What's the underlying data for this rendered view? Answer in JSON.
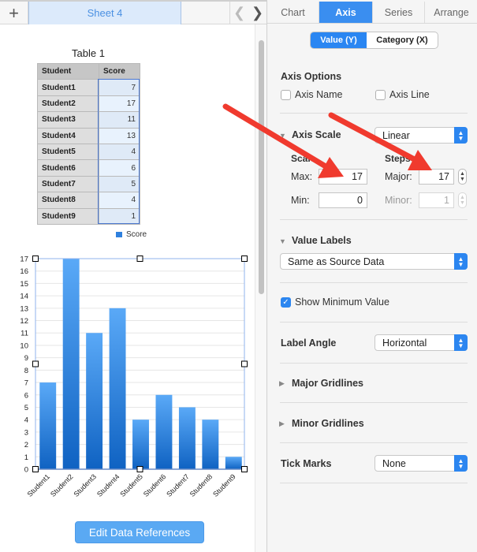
{
  "sheet_bar": {
    "add_icon": "plus-icon",
    "active_sheet": "Sheet 4",
    "prev_icon": "chevron-left-icon",
    "next_icon": "chevron-right-icon"
  },
  "table": {
    "title": "Table 1",
    "headers": [
      "Student",
      "Score"
    ],
    "rows": [
      {
        "student": "Student1",
        "score": "7"
      },
      {
        "student": "Student2",
        "score": "17"
      },
      {
        "student": "Student3",
        "score": "11"
      },
      {
        "student": "Student4",
        "score": "13"
      },
      {
        "student": "Student5",
        "score": "4"
      },
      {
        "student": "Student6",
        "score": "6"
      },
      {
        "student": "Student7",
        "score": "5"
      },
      {
        "student": "Student8",
        "score": "4"
      },
      {
        "student": "Student9",
        "score": "1"
      }
    ]
  },
  "chart_data": {
    "type": "bar",
    "categories": [
      "Student1",
      "Student2",
      "Student3",
      "Student4",
      "Student5",
      "Student6",
      "Student7",
      "Student8",
      "Student9"
    ],
    "series": [
      {
        "name": "Score",
        "values": [
          7,
          17,
          11,
          13,
          4,
          6,
          5,
          4,
          1
        ],
        "color": "#2f80de"
      }
    ],
    "title": "",
    "xlabel": "",
    "ylabel": "",
    "ylim": [
      0,
      17
    ],
    "yticks": [
      0,
      1,
      2,
      3,
      4,
      5,
      6,
      7,
      8,
      9,
      10,
      11,
      12,
      13,
      14,
      15,
      16,
      17
    ],
    "grid": true,
    "legend": "top-center",
    "x_label_rotation": "diagonal"
  },
  "edit_button": "Edit Data References",
  "inspector": {
    "tabs": [
      {
        "label": "Chart",
        "active": false
      },
      {
        "label": "Axis",
        "active": true
      },
      {
        "label": "Series",
        "active": false
      },
      {
        "label": "Arrange",
        "active": false
      }
    ],
    "segments": {
      "value": "Value (Y)",
      "category": "Category (X)",
      "selected": "Value (Y)"
    },
    "axis_options": {
      "heading": "Axis Options",
      "axis_name": {
        "label": "Axis Name",
        "checked": false
      },
      "axis_line": {
        "label": "Axis Line",
        "checked": false
      }
    },
    "axis_scale": {
      "heading": "Axis Scale",
      "select": "Linear",
      "scale_heading": "Scale",
      "steps_heading": "Steps",
      "max_label": "Max:",
      "max_value": "17",
      "min_label": "Min:",
      "min_value": "0",
      "major_label": "Major:",
      "major_value": "17",
      "minor_label": "Minor:",
      "minor_value": "1"
    },
    "value_labels": {
      "heading": "Value Labels",
      "select": "Same as Source Data"
    },
    "show_minimum": {
      "label": "Show Minimum Value",
      "checked": true
    },
    "label_angle": {
      "label": "Label Angle",
      "select": "Horizontal"
    },
    "major_gridlines": "Major Gridlines",
    "minor_gridlines": "Minor Gridlines",
    "tick_marks": {
      "label": "Tick Marks",
      "select": "None"
    }
  },
  "annotation": {
    "arrow_color": "#f03a2e"
  }
}
